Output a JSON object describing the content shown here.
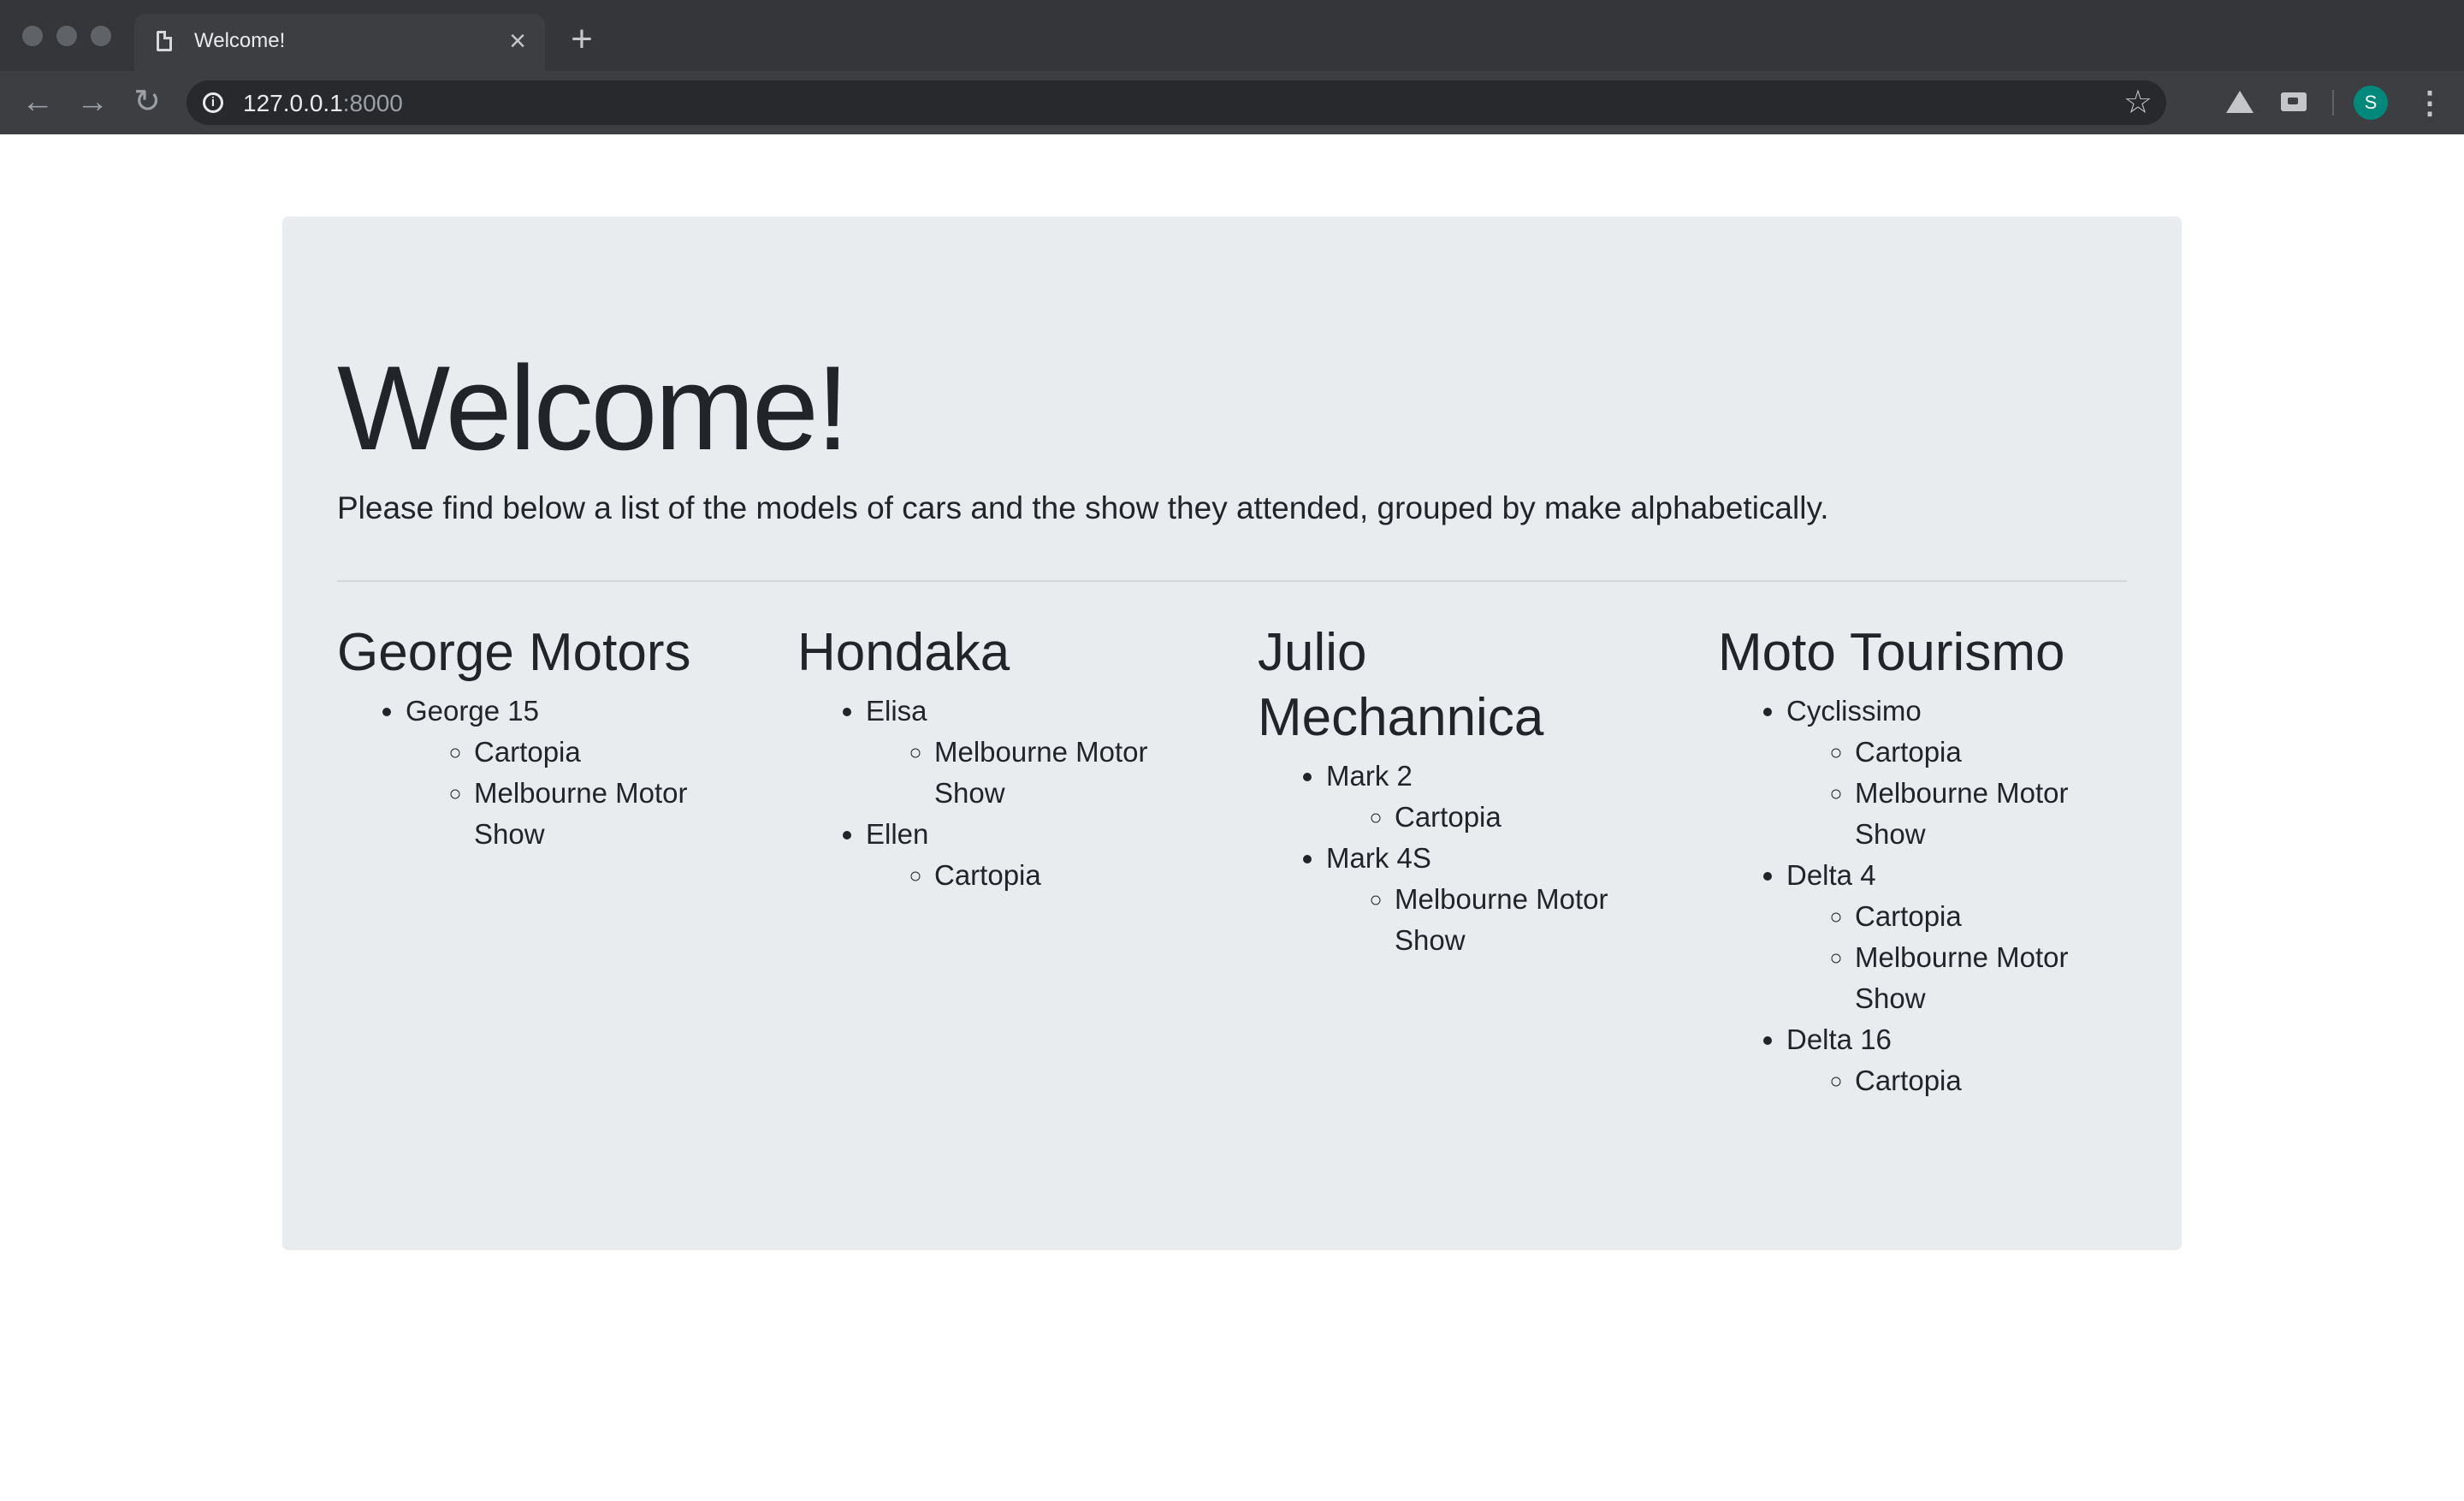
{
  "browser": {
    "tab_title": "Welcome!",
    "tab_close_glyph": "×",
    "new_tab_glyph": "+",
    "url_host": "127.0.0.1",
    "url_port": ":8000",
    "profile_initial": "S",
    "avatar_color": "#00897b"
  },
  "page": {
    "title": "Welcome!",
    "lead": "Please find below a list of the models of cars and the show they attended, grouped by make alphabetically."
  },
  "makes": [
    {
      "name": "George Motors",
      "models": [
        {
          "name": "George 15",
          "shows": [
            "Cartopia",
            "Melbourne Motor Show"
          ]
        }
      ]
    },
    {
      "name": "Hondaka",
      "models": [
        {
          "name": "Elisa",
          "shows": [
            "Melbourne Motor Show"
          ]
        },
        {
          "name": "Ellen",
          "shows": [
            "Cartopia"
          ]
        }
      ]
    },
    {
      "name": "Julio Mechannica",
      "models": [
        {
          "name": "Mark 2",
          "shows": [
            "Cartopia"
          ]
        },
        {
          "name": "Mark 4S",
          "shows": [
            "Melbourne Motor Show"
          ]
        }
      ]
    },
    {
      "name": "Moto Tourismo",
      "models": [
        {
          "name": "Cyclissimo",
          "shows": [
            "Cartopia",
            "Melbourne Motor Show"
          ]
        },
        {
          "name": "Delta 4",
          "shows": [
            "Cartopia",
            "Melbourne Motor Show"
          ]
        },
        {
          "name": "Delta 16",
          "shows": [
            "Cartopia"
          ]
        }
      ]
    }
  ]
}
